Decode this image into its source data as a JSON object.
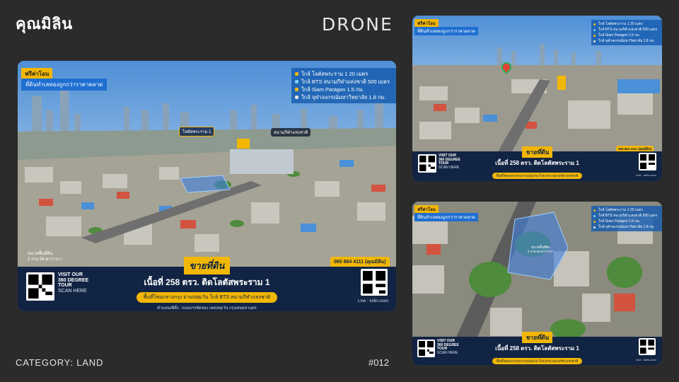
{
  "brand": "คุณมิลิน",
  "section_title": "DRONE",
  "category": "CATEGORY: LAND",
  "item_no": "#012",
  "listing": {
    "tag_free": "ฟรีค่าโอน",
    "tag_cheap": "ที่ดินทำเลทองถูกกว่าราคาตลาด",
    "info": [
      "ใกล้ โลตัสพระราม 1 20 เมตร",
      "ใกล้ BTS สนามกีฬาแห่งชาติ  500 เมตร",
      "ใกล้ Siam Paragon 1.5 กม.",
      "ใกล้ จุฬาลงกรณ์มหาวิทยาลัย 1.8 กม."
    ],
    "pin_landmark": "โลตัสพระราม 1",
    "pin_stadium": "สนามกีฬาแห่งชาติ",
    "plot_label": "ขนาดพื้นที่ดิน",
    "plot_size": "2 งาน 58 ตารางวา",
    "phone": "065 864 4111 (คุณมิลิน)",
    "visit": [
      "VISIT OUR",
      "360 DEGREE",
      "TOUR"
    ],
    "scan": "SCAN HERE",
    "headline": "ขายที่ดิน",
    "area": "เนื้อที่ 258 ตรว. ติดโลตัสพระราม 1",
    "strip": "พื้นที่โซนกลางกรุง ย่านปทุมวัน ใกล้ BTS สนามกีฬาแห่งชาติ",
    "address": "ตำแหน่งที่ตั้ง : ถนนบรรทัดทอง เขตปทุมวัน กรุงเทพมหานคร",
    "line": "Line : milin.xoxo"
  },
  "colors": {
    "background": "#2b2b2b",
    "accent": "#f2b705",
    "navy": "#122443",
    "blue": "#1f6fd1"
  }
}
